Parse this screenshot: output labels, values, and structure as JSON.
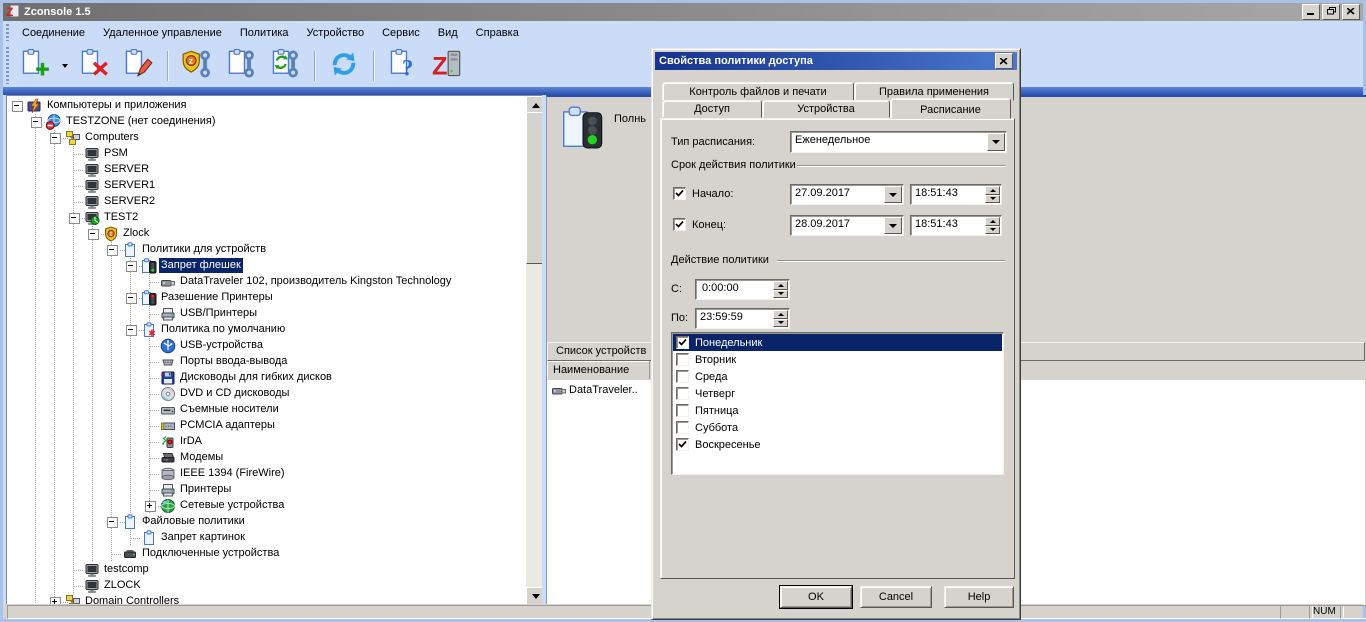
{
  "window": {
    "title": "Zconsole 1.5",
    "controls": [
      "minimize-button",
      "restore-button",
      "close-button"
    ]
  },
  "menu": {
    "items": [
      "Соединение",
      "Удаленное управление",
      "Политика",
      "Устройство",
      "Сервис",
      "Вид",
      "Справка"
    ]
  },
  "toolbar": {
    "buttons": [
      {
        "icon": "new-policy",
        "dropdown": true
      },
      {
        "icon": "delete-policy"
      },
      {
        "icon": "edit-policy"
      },
      {
        "sep": true
      },
      {
        "icon": "zlock-settings"
      },
      {
        "icon": "policy-settings"
      },
      {
        "icon": "sync-settings"
      },
      {
        "sep": true
      },
      {
        "icon": "refresh"
      },
      {
        "sep": true
      },
      {
        "icon": "help"
      },
      {
        "icon": "zlock-app"
      }
    ]
  },
  "tree": {
    "items": [
      {
        "level": 0,
        "label": "Компьютеры и приложения",
        "expander": "minus",
        "icon": "console"
      },
      {
        "level": 1,
        "label": "TESTZONE (нет соединения)",
        "expander": "minus",
        "icon": "globe-error"
      },
      {
        "level": 2,
        "label": "Computers",
        "expander": "minus",
        "icon": "network-group"
      },
      {
        "level": 3,
        "label": "PSM",
        "icon": "computer"
      },
      {
        "level": 3,
        "label": "SERVER",
        "icon": "computer"
      },
      {
        "level": 3,
        "label": "SERVER1",
        "icon": "computer"
      },
      {
        "level": 3,
        "label": "SERVER2",
        "icon": "computer"
      },
      {
        "level": 3,
        "label": "TEST2",
        "expander": "minus",
        "icon": "computer-active"
      },
      {
        "level": 4,
        "label": "Zlock",
        "expander": "minus",
        "icon": "shield"
      },
      {
        "level": 5,
        "label": "Политики для устройств",
        "expander": "minus",
        "icon": "policy-doc"
      },
      {
        "level": 6,
        "label": "Запрет флешек",
        "expander": "minus",
        "icon": "policy-green",
        "selected": true
      },
      {
        "level": 7,
        "label": "DataTraveler 102, производитель Kingston Technology",
        "icon": "flash-drive"
      },
      {
        "level": 6,
        "label": "Разешение Принтеры",
        "expander": "minus",
        "icon": "policy-red"
      },
      {
        "level": 7,
        "label": "USB/Принтеры",
        "icon": "printer"
      },
      {
        "level": 6,
        "label": "Политика по умолчанию",
        "expander": "minus",
        "icon": "policy-star"
      },
      {
        "level": 7,
        "label": "USB-устройства",
        "icon": "usb"
      },
      {
        "level": 7,
        "label": "Порты ввода-вывода",
        "icon": "port"
      },
      {
        "level": 7,
        "label": "Дисководы для гибких дисков",
        "icon": "floppy"
      },
      {
        "level": 7,
        "label": "DVD и CD дисководы",
        "icon": "cd"
      },
      {
        "level": 7,
        "label": "Съемные носители",
        "icon": "removable"
      },
      {
        "level": 7,
        "label": "PCMCIA адаптеры",
        "icon": "pcmcia"
      },
      {
        "level": 7,
        "label": "IrDA",
        "icon": "irda"
      },
      {
        "level": 7,
        "label": "Модемы",
        "icon": "modem"
      },
      {
        "level": 7,
        "label": "IEEE 1394 (FireWire)",
        "icon": "firewire"
      },
      {
        "level": 7,
        "label": "Принтеры",
        "icon": "printer"
      },
      {
        "level": 7,
        "label": "Сетевые устройства",
        "expander": "plus",
        "icon": "network-globe"
      },
      {
        "level": 5,
        "label": "Файловые политики",
        "expander": "minus",
        "icon": "policy-doc"
      },
      {
        "level": 6,
        "label": "Запрет картинок",
        "icon": "policy-doc"
      },
      {
        "level": 5,
        "label": "Подключенные устройства",
        "icon": "connected"
      },
      {
        "level": 3,
        "label": "testcomp",
        "icon": "computer"
      },
      {
        "level": 3,
        "label": "ZLOCK",
        "icon": "computer"
      },
      {
        "level": 2,
        "label": "Domain Controllers",
        "expander": "plus",
        "icon": "network-group"
      }
    ]
  },
  "right_panel": {
    "policy_status_text": "Полнь",
    "device_list_title": "Список устройств",
    "device_column_header": "Наименование",
    "device_item": "DataTraveler.."
  },
  "dialog": {
    "title": "Свойства политики доступа",
    "tabs_row1": [
      "Контроль файлов и печати",
      "Правила применения"
    ],
    "tabs_row2": [
      "Доступ",
      "Устройства",
      "Расписание"
    ],
    "active_tab": "Расписание",
    "schedule_type_label": "Тип расписания:",
    "schedule_type_value": "Еженедельное",
    "validity_group_label": "Срок действия политики",
    "start": {
      "label": "Начало:",
      "checked": true,
      "date": "27.09.2017",
      "time": "18:51:43"
    },
    "end": {
      "label": "Конец:",
      "checked": true,
      "date": "28.09.2017",
      "time": "18:51:43"
    },
    "action_group_label": "Действие политики",
    "from": {
      "label": "С:",
      "value": "0:00:00"
    },
    "to": {
      "label": "По:",
      "value": "23:59:59"
    },
    "days": [
      {
        "label": "Понедельник",
        "checked": true,
        "selected": true
      },
      {
        "label": "Вторник",
        "checked": false
      },
      {
        "label": "Среда",
        "checked": false
      },
      {
        "label": "Четверг",
        "checked": false
      },
      {
        "label": "Пятница",
        "checked": false
      },
      {
        "label": "Суббота",
        "checked": false
      },
      {
        "label": "Воскресенье",
        "checked": true
      }
    ],
    "buttons": {
      "ok": "OK",
      "cancel": "Cancel",
      "help": "Help"
    }
  },
  "status_bar": {
    "panes": [
      "",
      "",
      "NUM",
      ""
    ]
  },
  "colors": {
    "selection": "#0a246a",
    "face": "#d6d3ce",
    "dialog_title_from": "#16338e",
    "dialog_title_to": "#4a78cc",
    "band": "#cbdcf8"
  }
}
